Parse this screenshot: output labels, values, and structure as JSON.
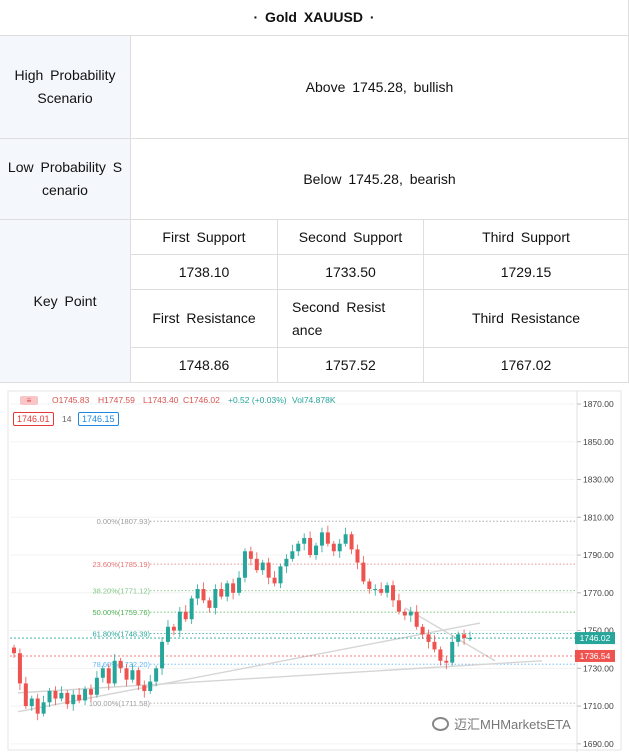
{
  "table": {
    "title": "· Gold XAUUSD ·",
    "high_label": "High Probability Scenario",
    "high_value": "Above 1745.28, bullish",
    "low_label": "Low Probability S cenario",
    "low_value": "Below 1745.28, bearish",
    "key_label": "Key Point",
    "support_headers": [
      "First Support",
      "Second Support",
      "Third Support"
    ],
    "support_values": [
      "1738.10",
      "1733.50",
      "1729.15"
    ],
    "resistance_headers": [
      "First Resistance",
      "Second Resist ance",
      "Third Resistance"
    ],
    "resistance_values": [
      "1748.86",
      "1757.52",
      "1767.02"
    ]
  },
  "chart_header": {
    "ohlc_o": "O1745.83",
    "ohlc_h": "H1747.59",
    "ohlc_l": "L1743.40",
    "ohlc_c": "C1746.02",
    "change": "+0.52 (+0.03%)",
    "volume": "Vol74.878K",
    "bid": "1746.01",
    "spread": "14",
    "ask": "1746.15"
  },
  "chart_data": {
    "type": "candlestick",
    "title": "",
    "ylim": [
      1688,
      1875
    ],
    "y_ticks": [
      "1870.00",
      "1850.00",
      "1830.00",
      "1810.00",
      "1790.00",
      "1770.00",
      "1750.00",
      "1730.00",
      "1710.00",
      "1690.00"
    ],
    "y_tick_values": [
      1870,
      1850,
      1830,
      1810,
      1790,
      1770,
      1750,
      1730,
      1710,
      1690
    ],
    "fib_levels": [
      {
        "label": "0.00%(1807.93)",
        "value": 1807.93,
        "color": "#9e9e9e"
      },
      {
        "label": "23.60%(1785.19)",
        "value": 1785.19,
        "color": "#e57373"
      },
      {
        "label": "38.20%(1771.12)",
        "value": 1771.12,
        "color": "#81c784"
      },
      {
        "label": "50.00%(1759.76)",
        "value": 1759.76,
        "color": "#4caf50"
      },
      {
        "label": "61.80%(1748.39)",
        "value": 1748.39,
        "color": "#26a69a"
      },
      {
        "label": "78.60%(1732.20)",
        "value": 1732.2,
        "color": "#64b5f6"
      },
      {
        "label": "100.00%(1711.58)",
        "value": 1711.58,
        "color": "#9e9e9e"
      }
    ],
    "price_tags": [
      {
        "label": "1746.02",
        "value": 1746.02,
        "color": "#26a69a"
      },
      {
        "label": "1736.54",
        "value": 1736.54,
        "color": "#ef5350"
      }
    ],
    "closes": [
      1738,
      1722,
      1710,
      1714,
      1706,
      1712,
      1718,
      1714,
      1717,
      1711,
      1716,
      1713,
      1719,
      1716,
      1725,
      1730,
      1722,
      1734,
      1730,
      1724,
      1729,
      1721,
      1718,
      1723,
      1730,
      1744,
      1752,
      1750,
      1760,
      1756,
      1767,
      1772,
      1766,
      1762,
      1772,
      1768,
      1775,
      1770,
      1778,
      1792,
      1788,
      1782,
      1786,
      1778,
      1775,
      1784,
      1788,
      1792,
      1796,
      1799,
      1790,
      1795,
      1802,
      1796,
      1792,
      1796,
      1801,
      1793,
      1786,
      1776,
      1772,
      1772,
      1770,
      1774,
      1766,
      1760,
      1758,
      1760,
      1752,
      1748,
      1744,
      1740,
      1734,
      1733,
      1744,
      1748,
      1746,
      1746
    ]
  },
  "watermark": "迈汇MHMarketsETA"
}
